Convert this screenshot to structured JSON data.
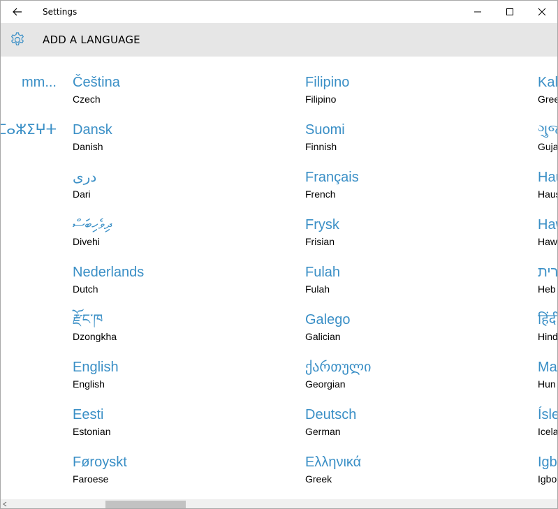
{
  "window": {
    "title": "Settings"
  },
  "header": {
    "page_title": "ADD A LANGUAGE"
  },
  "colors": {
    "accent": "#3a8fc6",
    "header_bg": "#e6e6e6",
    "scroll_thumb": "#c2c2c2"
  },
  "partial_column": [
    {
      "native": "mm..."
    },
    {
      "native": "ⵜⴰⵎⴰⵣⵉⵖⵜ"
    }
  ],
  "columns": [
    [
      {
        "native": "Čeština",
        "english": "Czech"
      },
      {
        "native": "Dansk",
        "english": "Danish"
      },
      {
        "native": "دری",
        "english": "Dari"
      },
      {
        "native": "ދިވެހިބަސް",
        "english": "Divehi"
      },
      {
        "native": "Nederlands",
        "english": "Dutch"
      },
      {
        "native": "རྫོང་ཁ",
        "english": "Dzongkha"
      },
      {
        "native": "English",
        "english": "English"
      },
      {
        "native": "Eesti",
        "english": "Estonian"
      },
      {
        "native": "Føroyskt",
        "english": "Faroese"
      }
    ],
    [
      {
        "native": "Filipino",
        "english": "Filipino"
      },
      {
        "native": "Suomi",
        "english": "Finnish"
      },
      {
        "native": "Français",
        "english": "French"
      },
      {
        "native": "Frysk",
        "english": "Frisian"
      },
      {
        "native": "Fulah",
        "english": "Fulah"
      },
      {
        "native": "Galego",
        "english": "Galician"
      },
      {
        "native": "ქართული",
        "english": "Georgian"
      },
      {
        "native": "Deutsch",
        "english": "German"
      },
      {
        "native": "Ελληνικά",
        "english": "Greek"
      }
    ],
    [
      {
        "native": "Kal",
        "english": "Gree"
      },
      {
        "native": "ગુજ",
        "english": "Guja"
      },
      {
        "native": "Hau",
        "english": "Haus"
      },
      {
        "native": "Haw",
        "english": "Haw"
      },
      {
        "native": "עברית",
        "english": "Heb"
      },
      {
        "native": "हिंदी",
        "english": "Hind"
      },
      {
        "native": "Ma",
        "english": "Hun"
      },
      {
        "native": "Ísle",
        "english": "Icela"
      },
      {
        "native": "Igb",
        "english": "Igbo"
      }
    ]
  ]
}
